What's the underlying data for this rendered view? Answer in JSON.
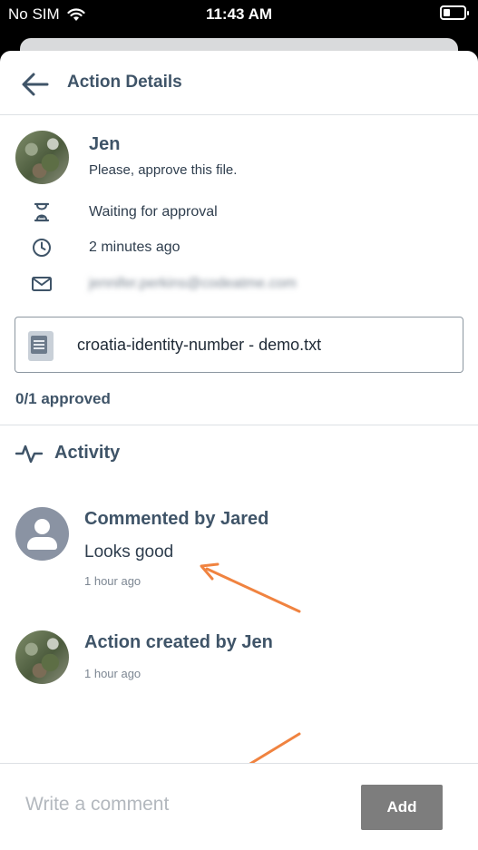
{
  "status_bar": {
    "carrier": "No SIM",
    "time": "11:43 AM"
  },
  "header": {
    "title": "Action Details"
  },
  "owner": {
    "name": "Jen",
    "message": "Please, approve this file."
  },
  "details": {
    "status": "Waiting for approval",
    "time_ago": "2 minutes ago",
    "email": "jennifer.perkins@codeatme.com"
  },
  "file": {
    "name": "croatia-identity-number - demo.txt"
  },
  "approval": {
    "summary": "0/1 approved"
  },
  "activity": {
    "title": "Activity",
    "items": [
      {
        "title": "Commented by Jared",
        "comment": "Looks good",
        "time": "1 hour ago"
      },
      {
        "title": "Action created by Jen",
        "time": "1 hour ago"
      }
    ]
  },
  "composer": {
    "placeholder": "Write a comment",
    "button_label": "Add"
  },
  "colors": {
    "annotation_arrow": "#f08340",
    "add_button": "#7d7d7d",
    "text_dark": "#3f5468"
  }
}
